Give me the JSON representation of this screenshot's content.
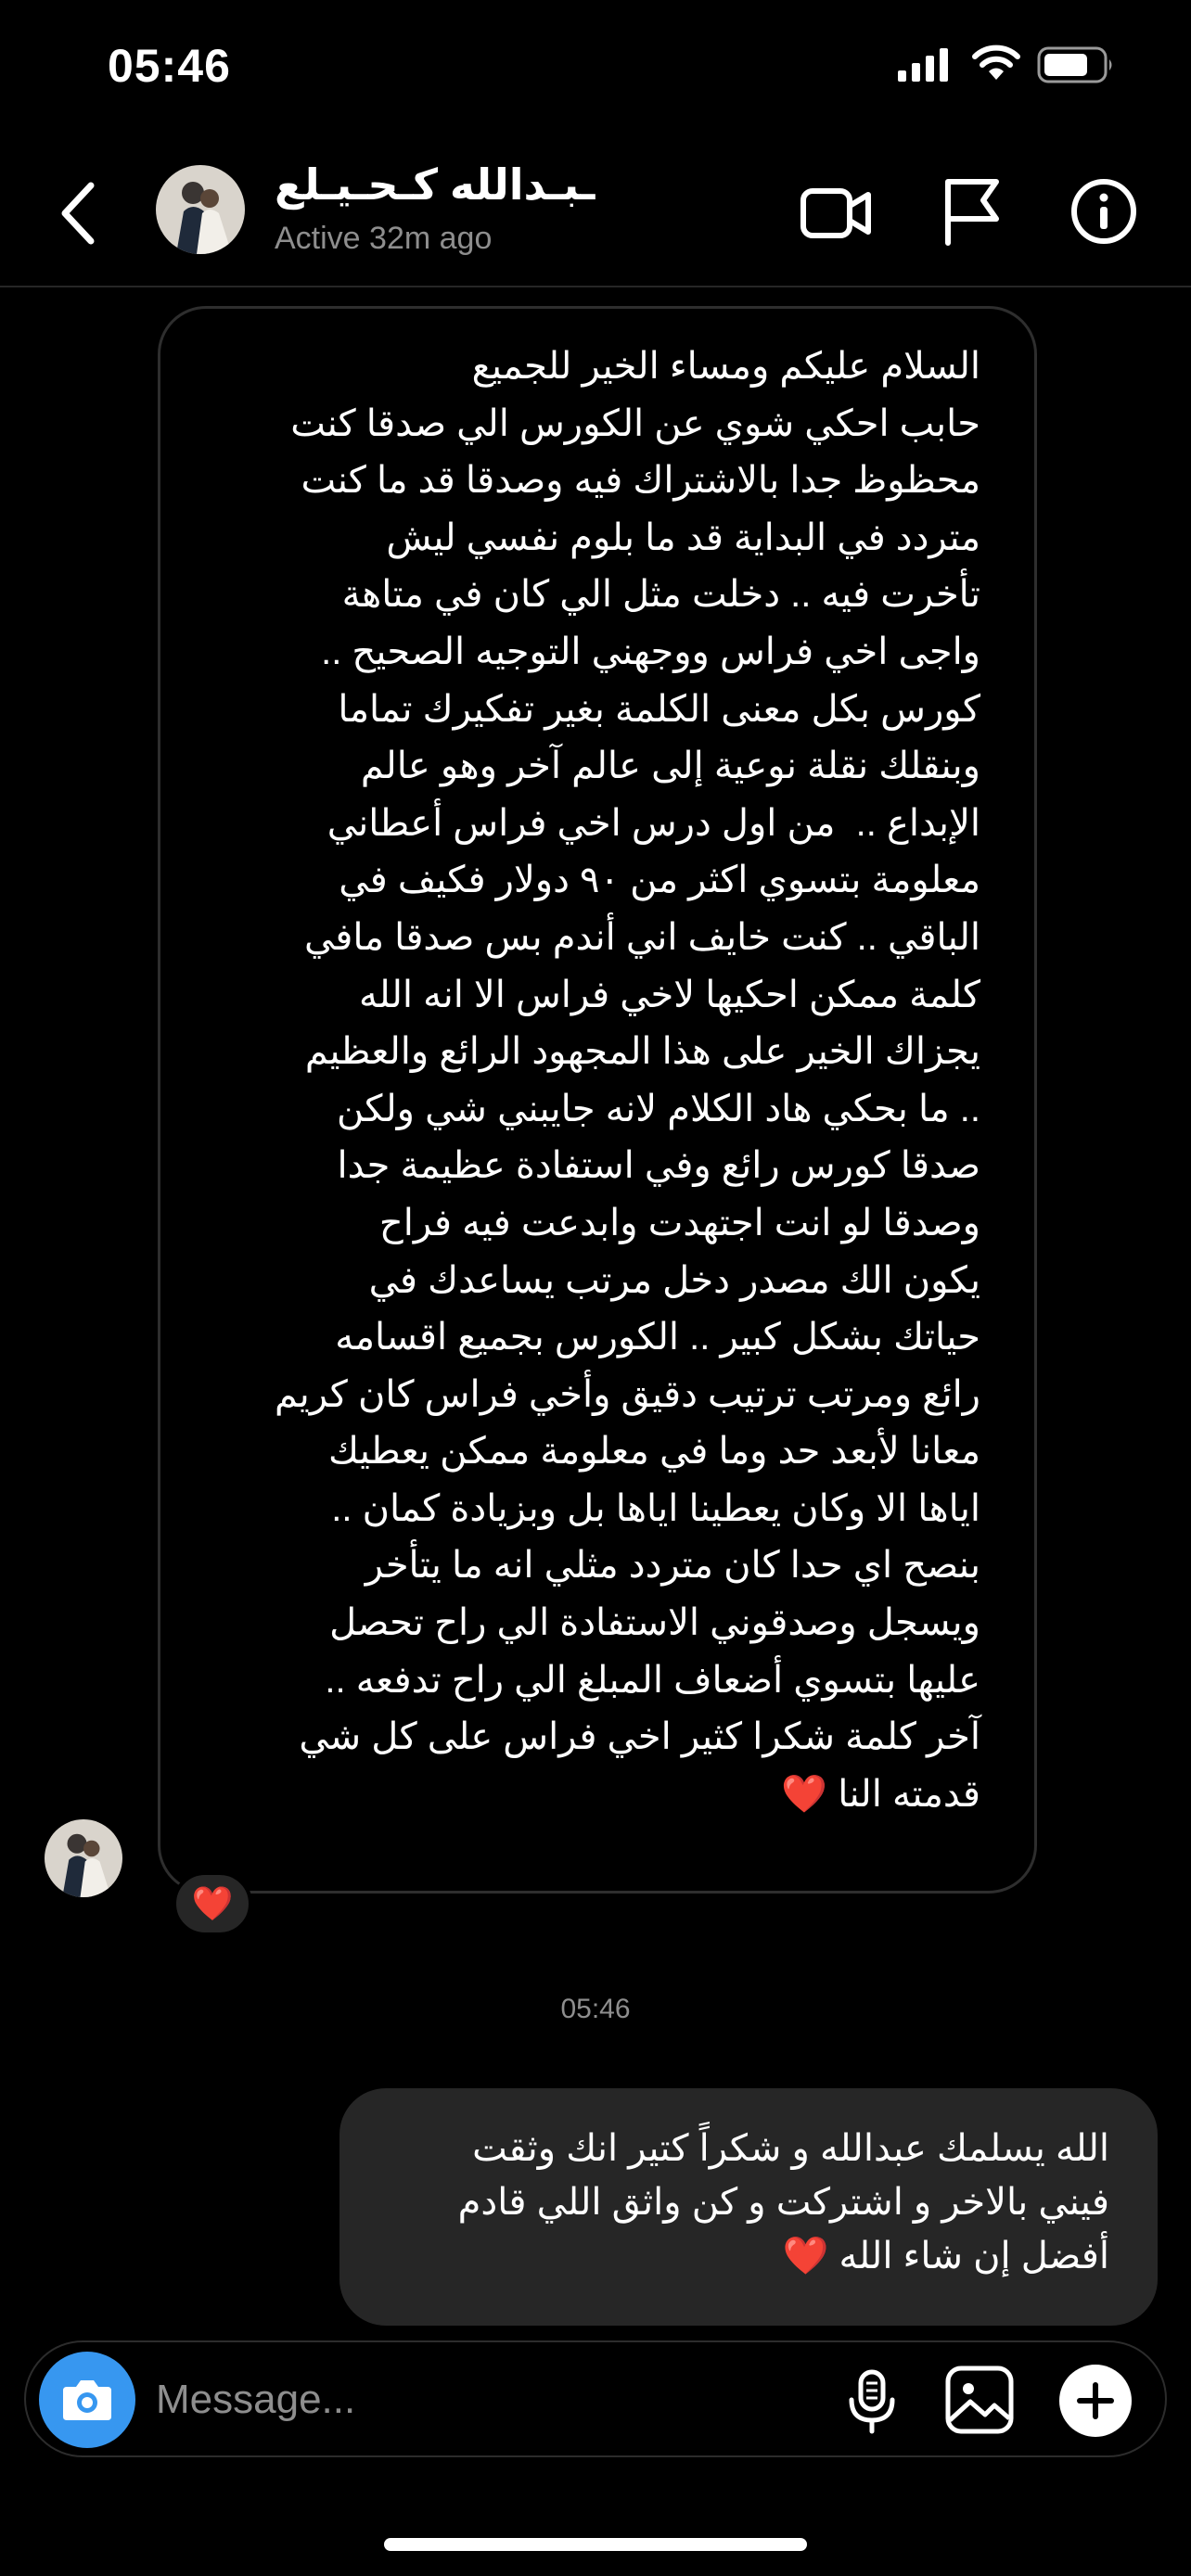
{
  "status_bar": {
    "time": "05:46",
    "icons": [
      "cellular-signal-icon",
      "wifi-icon",
      "battery-icon"
    ]
  },
  "header": {
    "contact_name": "ـبـدالله كـحـيـلع",
    "status": "Active 32m ago",
    "icons": [
      "back-arrow-icon",
      "video-call-icon",
      "flag-icon",
      "info-icon"
    ]
  },
  "messages": {
    "received": {
      "lines": [
        "السلام عليكم ومساء الخير للجميع",
        "حابب احكي شوي عن الكورس الي صدقا كنت",
        "محظوظ جدا بالاشتراك فيه وصدقا قد ما كنت",
        "متردد في البداية قد ما بلوم نفسي ليش",
        "تأخرت فيه .. دخلت مثل الي كان في متاهة",
        "واجى اخي فراس ووجهني التوجيه الصحيح ..",
        "كورس بكل معنى الكلمة بغير تفكيرك تماما",
        "وبنقلك نقلة نوعية إلى عالم آخر وهو عالم",
        "الإبداع ..  من اول درس اخي فراس أعطاني",
        "معلومة بتسوي اكثر من ٩٠ دولار فكيف في",
        "الباقي .. كنت خايف اني أندم بس صدقا مافي",
        "كلمة ممكن احكيها لاخي فراس الا انه الله",
        "يجزاك الخير على هذا المجهود الرائع والعظيم",
        ".. ما بحكي هاد الكلام لانه جايبني شي ولكن",
        "صدقا كورس رائع وفي استفادة عظيمة جدا",
        "وصدقا لو انت اجتهدت وابدعت فيه فراح",
        "يكون الك مصدر دخل مرتب يساعدك في",
        "حياتك بشكل كبير .. الكورس بجميع اقسامه",
        "رائع ومرتب ترتيب دقيق وأخي فراس كان كريم",
        "معانا لأبعد حد وما في معلومة ممكن يعطيك",
        "اياها الا وكان يعطينا اياها بل وبزيادة كمان ..",
        "بنصح اي حدا كان متردد مثلي انه ما يتأخر",
        "ويسجل وصدقوني الاستفادة الي راح تحصل",
        "عليها بتسوي أضعاف المبلغ الي راح تدفعه ..",
        "آخر كلمة شكرا كثير اخي فراس على كل شي"
      ],
      "last_line": "قدمته النا",
      "heart": "❤️",
      "reaction": "❤️"
    },
    "timestamp": "05:46",
    "sent": {
      "lines": [
        "الله يسلمك عبدالله و شكراً كتير انك وثقت",
        "فيني بالاخر و اشتركت و كن واثق اللي قادم"
      ],
      "last_line": "أفضل إن شاء الله",
      "heart": "❤️"
    }
  },
  "composer": {
    "placeholder": "Message...",
    "icons": [
      "camera-icon",
      "microphone-icon",
      "gallery-icon",
      "plus-icon"
    ]
  },
  "colors": {
    "background": "#000000",
    "bubble_sent": "#262626",
    "bubble_border": "#2e2e2e",
    "secondary_text": "#8e8e8e",
    "camera_blue": "#3797f0",
    "heart_red": "#ff2d40"
  }
}
